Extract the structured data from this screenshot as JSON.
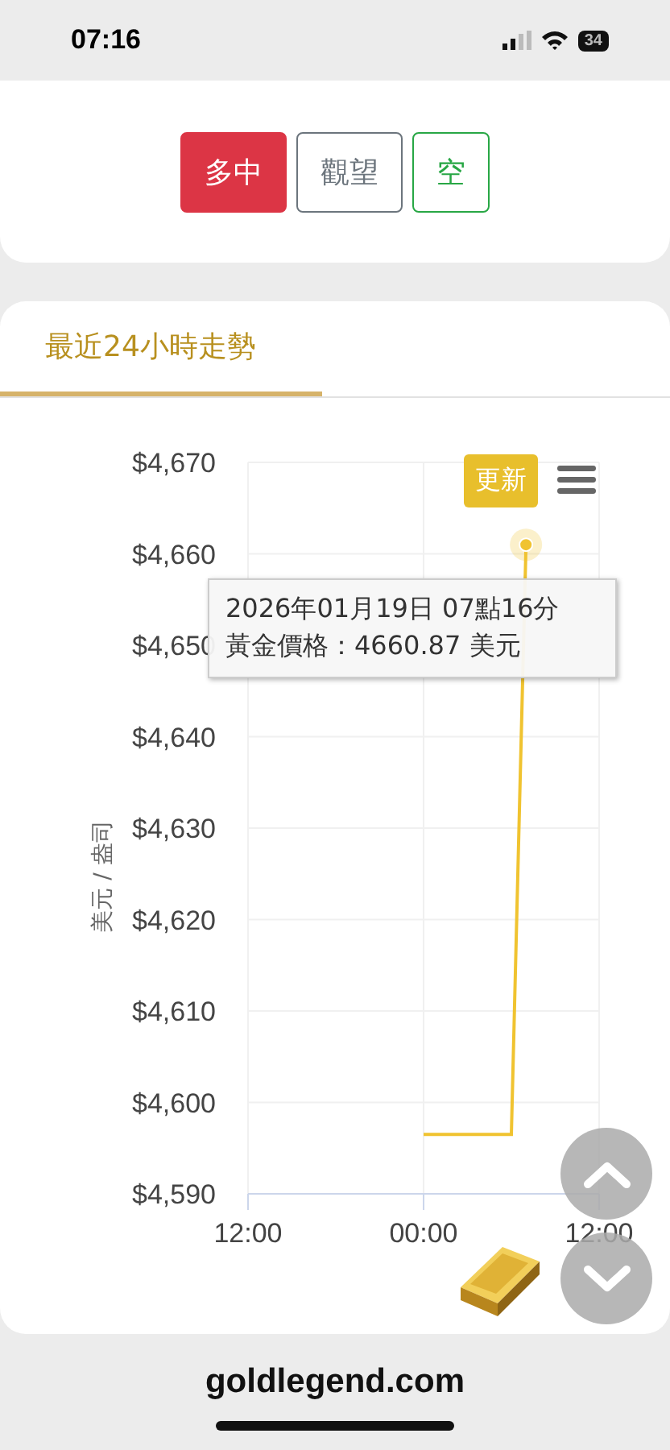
{
  "status_bar": {
    "time": "07:16",
    "battery": "34"
  },
  "signal_buttons": [
    {
      "label": "多中",
      "kind": "bull",
      "selected": true
    },
    {
      "label": "觀望",
      "kind": "neutral",
      "selected": false
    },
    {
      "label": "空",
      "kind": "bear",
      "selected": false
    }
  ],
  "tabs": [
    {
      "label": "最近24小時走勢",
      "selected": true
    }
  ],
  "chart": {
    "update_button": "更新",
    "tooltip": {
      "lines": [
        "2026年01月19日 07點16分",
        "黃金價格：4660.87 美元"
      ]
    },
    "chart_data": {
      "type": "line",
      "ylabel": "美元 / 盎司",
      "categories": [
        "12:00",
        null,
        null,
        null,
        null,
        null,
        null,
        null,
        null,
        null,
        null,
        null,
        "00:00",
        null,
        null,
        null,
        null,
        null,
        null,
        null,
        null,
        null,
        null,
        null,
        "12:00"
      ],
      "series": [
        {
          "color": "#f0c330",
          "values": [
            null,
            null,
            null,
            null,
            null,
            null,
            null,
            null,
            null,
            null,
            null,
            null,
            4596.5,
            4596.5,
            4596.5,
            4596.5,
            4596.5,
            4596.5,
            4596.5,
            4661,
            null,
            null,
            null,
            null,
            null
          ]
        }
      ],
      "ylim": [
        4590,
        4670
      ],
      "grid": true,
      "yticks": [
        {
          "value": 4590,
          "label": "$4,590"
        },
        {
          "value": 4600,
          "label": "$4,600"
        },
        {
          "value": 4610,
          "label": "$4,610"
        },
        {
          "value": 4620,
          "label": "$4,620"
        },
        {
          "value": 4630,
          "label": "$4,630"
        },
        {
          "value": 4640,
          "label": "$4,640"
        },
        {
          "value": 4650,
          "label": "$4,650"
        },
        {
          "value": 4660,
          "label": "$4,660"
        },
        {
          "value": 4670,
          "label": "$4,670"
        }
      ]
    }
  },
  "url_bar": {
    "address": "goldlegend.com"
  }
}
